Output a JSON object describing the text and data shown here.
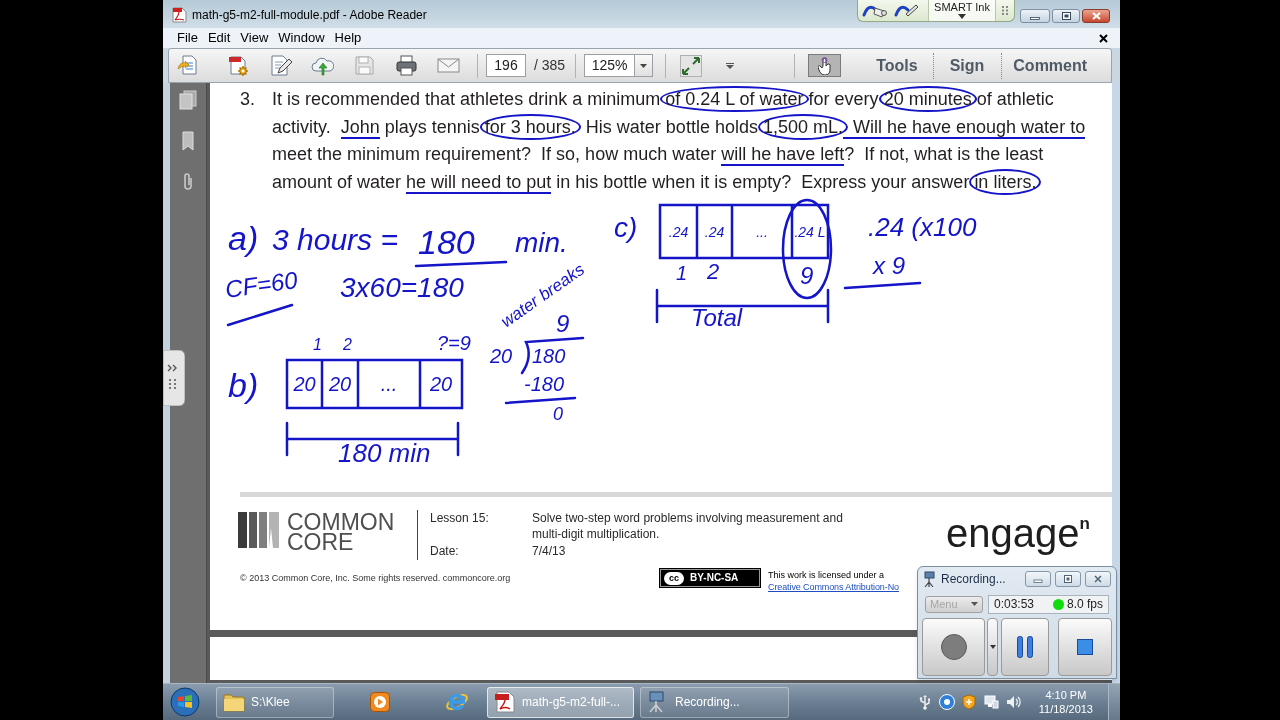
{
  "window": {
    "title": "math-g5-m2-full-module.pdf - Adobe Reader",
    "smart_ink": {
      "label": "SMART Ink"
    }
  },
  "menu_bar": [
    "File",
    "Edit",
    "View",
    "Window",
    "Help"
  ],
  "toolbar": {
    "page": "196",
    "page_count": "/ 385",
    "zoom": "125%",
    "hand_tool": {
      "selected": true
    },
    "panes": [
      "Tools",
      "Sign",
      "Comment"
    ]
  },
  "document": {
    "problem": {
      "number": "3.",
      "lines": [
        [
          {
            "text": "It is recommended that athletes drink a minimum ",
            "circled": false,
            "underlined": false
          },
          {
            "text": "of 0.24 L of water",
            "circled": true,
            "underlined": false
          },
          {
            "text": " for every ",
            "circled": false,
            "underlined": false
          },
          {
            "text": "20 minutes",
            "circled": true,
            "underlined": false
          },
          {
            "text": " of athletic",
            "circled": false,
            "underlined": false
          }
        ],
        [
          {
            "text": "activity.  ",
            "circled": false,
            "underlined": false
          },
          {
            "text": "John",
            "circled": false,
            "underlined": true
          },
          {
            "text": " plays tennis ",
            "circled": false,
            "underlined": false
          },
          {
            "text": "for 3 hours.",
            "circled": true,
            "underlined": false
          },
          {
            "text": "  His water bottle holds ",
            "circled": false,
            "underlined": false
          },
          {
            "text": "1,500 mL.",
            "circled": true,
            "underlined": false
          },
          {
            "text": "  Will he have enough water to",
            "circled": false,
            "underlined": true
          }
        ],
        [
          {
            "text": "meet the minimum requirement?  If so, how much water ",
            "circled": false,
            "underlined": false
          },
          {
            "text": "will he have left",
            "circled": false,
            "underlined": true
          },
          {
            "text": "?  If not, what is the least",
            "circled": false,
            "underlined": false
          }
        ],
        [
          {
            "text": "amount of water ",
            "circled": false,
            "underlined": false
          },
          {
            "text": "he will need to put",
            "circled": false,
            "underlined": true
          },
          {
            "text": " in his bottle when it is empty?  Express your answer ",
            "circled": false,
            "underlined": false
          },
          {
            "text": "in liters.",
            "circled": true,
            "underlined": false
          }
        ]
      ]
    },
    "handwriting": {
      "part_a": {
        "label": "a)",
        "equation": "3 hours =",
        "result": "180",
        "unit": "min.",
        "factor": "CF=60",
        "work": "3x60=180"
      },
      "part_b": {
        "label": "b)",
        "position_marks": [
          "1",
          "2"
        ],
        "unknown": "?=9",
        "note": "water breaks",
        "tape": [
          "20",
          "20",
          "...",
          "20"
        ],
        "total": "180 min",
        "division": {
          "quotient": "9",
          "divisor": "20",
          "dividend": "180",
          "product": "-180",
          "remainder": "0"
        }
      },
      "part_c": {
        "label": "c)",
        "tape": [
          ".24",
          ".24",
          "...",
          ".24 L"
        ],
        "position_marks": [
          "1",
          "2"
        ],
        "count": "9",
        "total": "Total",
        "multiplication": [
          ".24 (x100",
          "x 9"
        ]
      }
    },
    "footer": {
      "logo": [
        "COMMON",
        "CORE"
      ],
      "lesson_label": "Lesson 15:",
      "lesson_title": [
        "Solve two-step word problems involving measurement and",
        "multi-digit multiplication."
      ],
      "date_label": "Date:",
      "date": "7/4/13",
      "brand": "engage$^{n}$",
      "copyright": "© 2013 Common Core, Inc. Some rights reserved. commoncore.org",
      "license": {
        "symbol": "cc",
        "badge": "BY-NC-SA",
        "text": "This work is licensed under a",
        "link": "Creative Commons Attribution-No"
      }
    }
  },
  "recorder": {
    "title": "Recording...",
    "menu": {
      "label": "Menu",
      "disabled": true
    },
    "elapsed": "0:03:53",
    "frame_rate": "8.0 fps"
  },
  "taskbar": {
    "windows": [
      {
        "label": "S:\\Klee",
        "selected": false
      },
      {
        "label": "math-g5-m2-full-...",
        "selected": true
      },
      {
        "label": "Recording...",
        "selected": false
      }
    ],
    "clock": {
      "time": "4:10 PM",
      "date": "11/18/2013"
    }
  }
}
